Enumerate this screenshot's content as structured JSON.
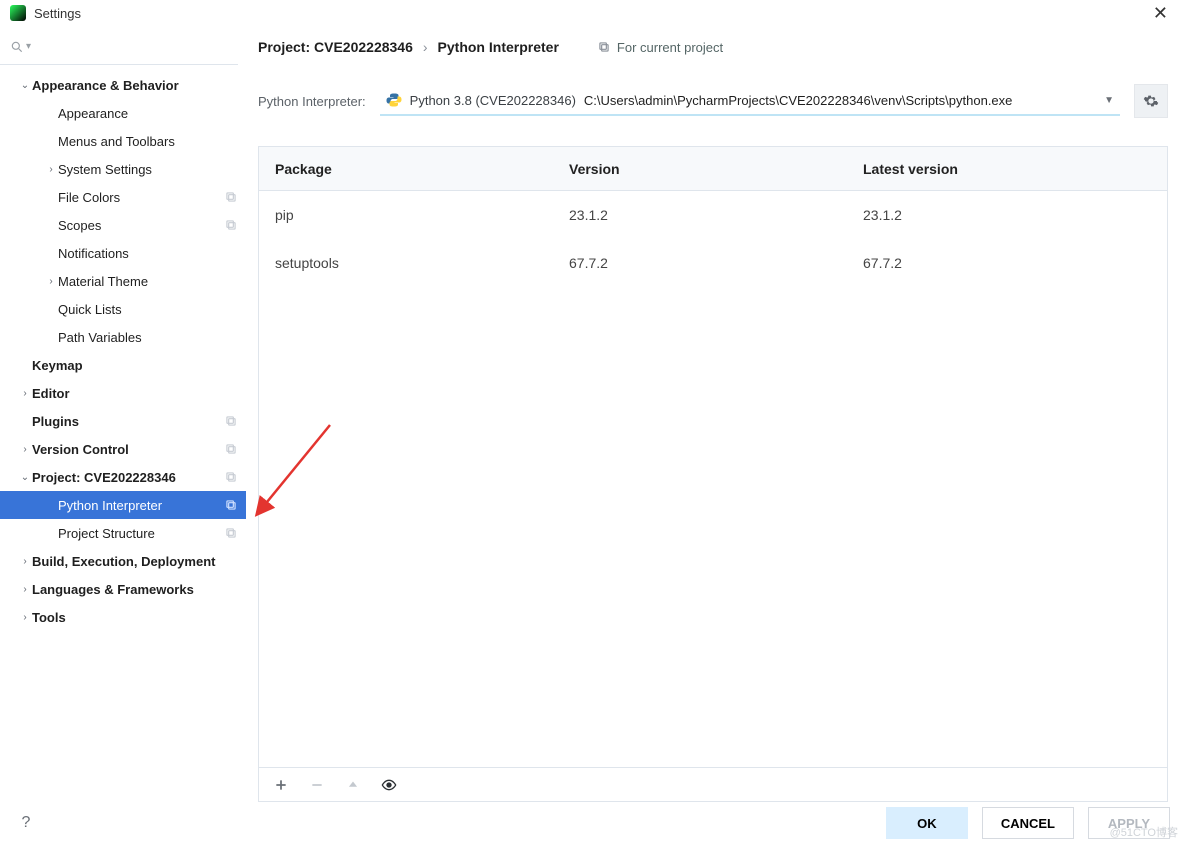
{
  "window": {
    "title": "Settings"
  },
  "breadcrumb": {
    "project_label": "Project: CVE202228346",
    "page": "Python Interpreter",
    "badge": "For current project"
  },
  "interpreter": {
    "label": "Python Interpreter:",
    "name": "Python 3.8 (CVE202228346)",
    "path": "C:\\Users\\admin\\PycharmProjects\\CVE202228346\\venv\\Scripts\\python.exe"
  },
  "packages": {
    "headers": {
      "pkg": "Package",
      "ver": "Version",
      "lat": "Latest version"
    },
    "rows": [
      {
        "name": "pip",
        "version": "23.1.2",
        "latest": "23.1.2"
      },
      {
        "name": "setuptools",
        "version": "67.7.2",
        "latest": "67.7.2"
      }
    ]
  },
  "sidebar": [
    {
      "label": "Appearance & Behavior",
      "level": 0,
      "bold": true,
      "arrow": "down"
    },
    {
      "label": "Appearance",
      "level": 1
    },
    {
      "label": "Menus and Toolbars",
      "level": 1
    },
    {
      "label": "System Settings",
      "level": 1,
      "arrow": "right"
    },
    {
      "label": "File Colors",
      "level": 1,
      "cfg": true
    },
    {
      "label": "Scopes",
      "level": 1,
      "cfg": true
    },
    {
      "label": "Notifications",
      "level": 1
    },
    {
      "label": "Material Theme",
      "level": 1,
      "arrow": "right"
    },
    {
      "label": "Quick Lists",
      "level": 1
    },
    {
      "label": "Path Variables",
      "level": 1
    },
    {
      "label": "Keymap",
      "level": 0,
      "bold": true,
      "noarrow": true
    },
    {
      "label": "Editor",
      "level": 0,
      "bold": true,
      "arrow": "right"
    },
    {
      "label": "Plugins",
      "level": 0,
      "bold": true,
      "noarrow": true,
      "cfg": true
    },
    {
      "label": "Version Control",
      "level": 0,
      "bold": true,
      "arrow": "right",
      "cfg": true
    },
    {
      "label": "Project: CVE202228346",
      "level": 0,
      "bold": true,
      "arrow": "down",
      "cfg": true
    },
    {
      "label": "Python Interpreter",
      "level": 1,
      "cfg": true,
      "selected": true
    },
    {
      "label": "Project Structure",
      "level": 1,
      "cfg": true
    },
    {
      "label": "Build, Execution, Deployment",
      "level": 0,
      "bold": true,
      "arrow": "right"
    },
    {
      "label": "Languages & Frameworks",
      "level": 0,
      "bold": true,
      "arrow": "right"
    },
    {
      "label": "Tools",
      "level": 0,
      "bold": true,
      "arrow": "right"
    }
  ],
  "buttons": {
    "ok": "OK",
    "cancel": "CANCEL",
    "apply": "APPLY"
  },
  "watermark": "@51CTO博客"
}
